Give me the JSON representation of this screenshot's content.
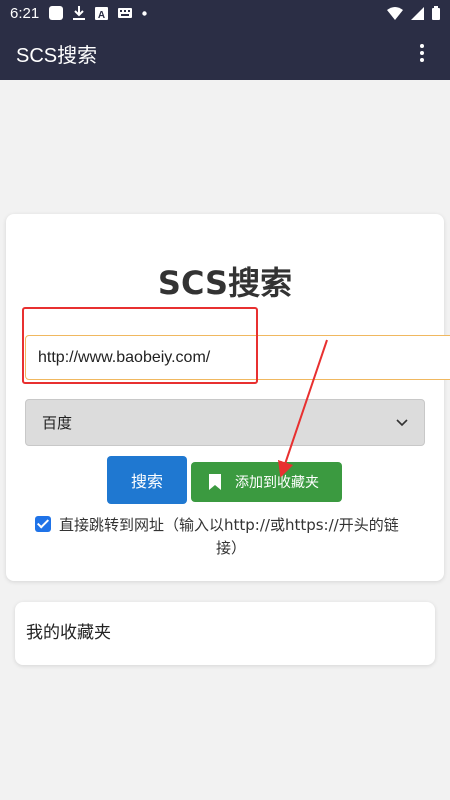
{
  "status_bar": {
    "time": "6:21",
    "icons": [
      "app-icon",
      "download-icon",
      "font-icon",
      "keyboard-icon",
      "dot-icon",
      "wifi-icon",
      "signal-icon",
      "battery-icon"
    ]
  },
  "app_bar": {
    "title": "SCS搜索",
    "menu_icon": "more-vert-icon"
  },
  "search": {
    "heading": "SCS搜索",
    "url_value": "http://www.baobeiy.com/",
    "engine_selected": "百度",
    "search_button": "搜索",
    "bookmark_button": "添加到收藏夹",
    "direct_jump_checked": true,
    "direct_jump_label_line1": "直接跳转到网址（输入以http://或https://开头的链",
    "direct_jump_label_line2": "接）"
  },
  "favorites": {
    "title": "我的收藏夹"
  },
  "colors": {
    "app_bar": "#2b2e45",
    "search_button": "#1f78d1",
    "bookmark_button": "#3b9a40",
    "highlight": "#e83030",
    "input_border": "#f0b860"
  }
}
